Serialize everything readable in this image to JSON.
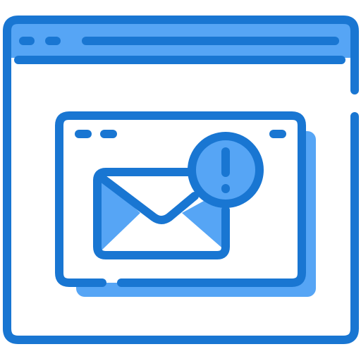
{
  "icon": {
    "name": "browser-email-alert-icon",
    "colors": {
      "stroke": "#1976d2",
      "fill_light": "#56a5f5",
      "fill_dark": "#4b97e8",
      "background": "#ffffff"
    },
    "parts": [
      "browser-window-icon",
      "popup-window-icon",
      "envelope-icon",
      "exclamation-badge-icon"
    ]
  }
}
